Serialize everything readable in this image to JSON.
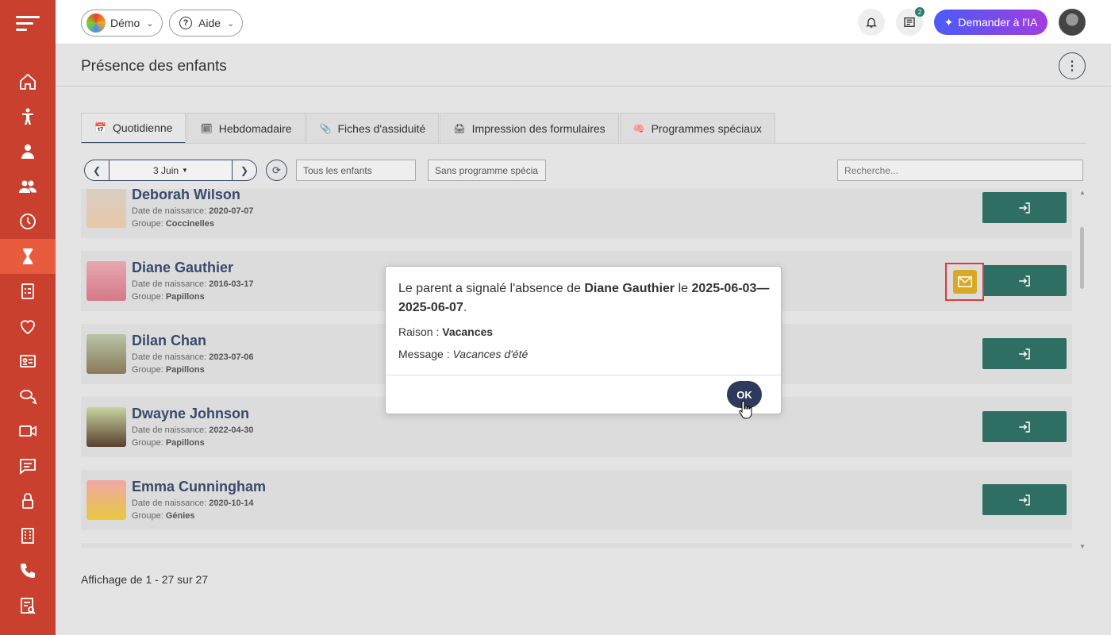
{
  "topbar": {
    "demo_label": "Démo",
    "help_label": "Aide",
    "ai_label": "Demander à l'IA",
    "notif_badge": "2"
  },
  "page": {
    "title": "Présence des enfants"
  },
  "tabs": [
    {
      "label": "Quotidienne",
      "icon": "calendar-day-icon"
    },
    {
      "label": "Hebdomadaire",
      "icon": "calendar-week-icon"
    },
    {
      "label": "Fiches d'assiduité",
      "icon": "clip-icon"
    },
    {
      "label": "Impression des formulaires",
      "icon": "printer-icon"
    },
    {
      "label": "Programmes spéciaux",
      "icon": "brain-icon"
    }
  ],
  "filters": {
    "date": "3 Juin",
    "children_filter": "Tous les enfants",
    "program_filter": "Sans programme spécia",
    "search_placeholder": "Recherche..."
  },
  "children": [
    {
      "name": "Deborah Wilson",
      "birth_label": "Date de naissance:",
      "birth": "2020-07-07",
      "group_label": "Groupe:",
      "group": "Coccinelles"
    },
    {
      "name": "Diane Gauthier",
      "birth_label": "Date de naissance:",
      "birth": "2016-03-17",
      "group_label": "Groupe:",
      "group": "Papillons"
    },
    {
      "name": "Dilan Chan",
      "birth_label": "Date de naissance:",
      "birth": "2023-07-06",
      "group_label": "Groupe:",
      "group": "Papillons"
    },
    {
      "name": "Dwayne Johnson",
      "birth_label": "Date de naissance:",
      "birth": "2022-04-30",
      "group_label": "Groupe:",
      "group": "Papillons"
    },
    {
      "name": "Emma Cunningham",
      "birth_label": "Date de naissance:",
      "birth": "2020-10-14",
      "group_label": "Groupe:",
      "group": "Génies"
    }
  ],
  "footer": {
    "pagination": "Affichage de 1 - 27 sur 27"
  },
  "modal": {
    "text_prefix": "Le parent a signalé l'absence de ",
    "child": "Diane Gauthier",
    "text_mid": " le ",
    "dates": "2025-06-03—2025-06-07",
    "text_end": ".",
    "reason_label": "Raison : ",
    "reason": "Vacances",
    "message_label": "Message : ",
    "message": "Vacances d'été",
    "ok": "OK"
  },
  "colors": {
    "sidebar": "#c9412e",
    "sidebar_active": "#e85c3d",
    "signin_button": "#2e6e63",
    "ok_button": "#2d3a5c",
    "message_icon": "#d9a826",
    "highlight": "#e03a3a"
  }
}
